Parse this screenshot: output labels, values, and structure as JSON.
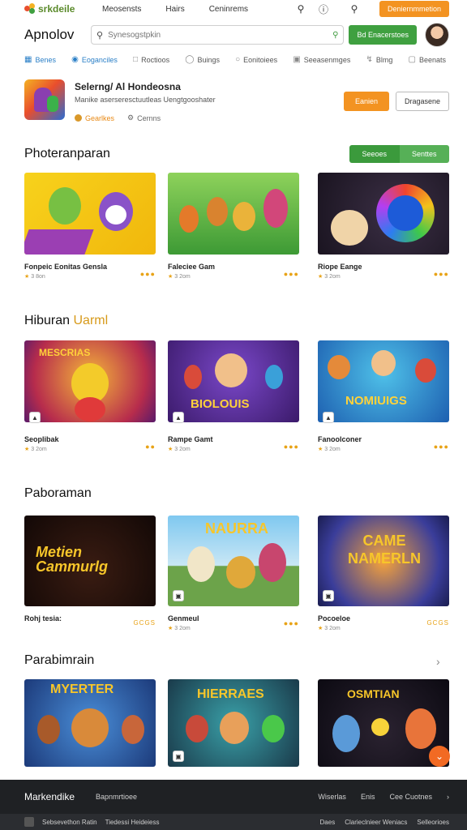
{
  "topbar": {
    "brand": "srkdeile",
    "nav": [
      "Meosensts",
      "Hairs",
      "Ceninrems"
    ],
    "cta": "Deniernmmetion"
  },
  "header": {
    "title": "Apnolov",
    "search_placeholder": "Synesogstpkin",
    "green_button": "Bd Enacerstoes"
  },
  "categories": [
    {
      "label": "Benes",
      "icon": "grid-icon",
      "active": true
    },
    {
      "label": "Eoganciles",
      "icon": "controller-icon",
      "active": true
    },
    {
      "label": "Roctioos",
      "icon": "square-icon",
      "active": false
    },
    {
      "label": "Buings",
      "icon": "shield-icon",
      "active": false
    },
    {
      "label": "Eonitoiees",
      "icon": "circle-icon",
      "active": false
    },
    {
      "label": "Seeasenmges",
      "icon": "box-icon",
      "active": false
    },
    {
      "label": "Blmg",
      "icon": "bolt-icon",
      "active": false
    },
    {
      "label": "Beenats",
      "icon": "tag-icon",
      "active": false
    }
  ],
  "featured": {
    "title": "Selerng/ Al Hondeosna",
    "subtitle": "Manike aserseresctuutleas Uengtgooshater",
    "meta1": "Gearlkes",
    "meta2": "Cernns",
    "primary_btn": "Eanien",
    "secondary_btn": "Dragasene"
  },
  "sections": [
    {
      "title": "Photeranparan",
      "title_highlight": "",
      "segment": [
        "Seeoes",
        "Senttes"
      ],
      "cards": [
        {
          "name": "Fonpeic Eonitas Gensla",
          "stat": "3 8on"
        },
        {
          "name": "Faleciee Gam",
          "stat": "3 2om"
        },
        {
          "name": "Riope Eange",
          "stat": "3 2om"
        }
      ]
    },
    {
      "title": "Hiburan",
      "title_highlight": "Uarml",
      "cards": [
        {
          "name": "Seoplibak",
          "stat": "3 2om"
        },
        {
          "name": "Rampe Gamt",
          "stat": "3 2om"
        },
        {
          "name": "Fanoolconer",
          "stat": "3 2om"
        }
      ]
    },
    {
      "title": "Paboraman",
      "title_highlight": "",
      "cards": [
        {
          "name": "Rohj tesia:",
          "stat": "",
          "dots": "GCGS"
        },
        {
          "name": "Genmeul",
          "stat": "3 2om"
        },
        {
          "name": "Pocoeloe",
          "stat": "3 2om",
          "dots": "GCGS"
        }
      ]
    },
    {
      "title": "Parabimrain",
      "title_highlight": "",
      "cards": [
        {
          "name": "",
          "stat": ""
        },
        {
          "name": "",
          "stat": ""
        },
        {
          "name": "",
          "stat": ""
        }
      ]
    }
  ],
  "thumb_text": {
    "r2c1": "MESCRIAS",
    "r2c2": "BIOLOUIS",
    "r2c3": "NOMIUIGS",
    "r3c1": "Metien Cammurlg",
    "r3c2": "NAURRA",
    "r3c3": "CAME NAMERLN",
    "r4c1": "MYERTER",
    "r4c2": "HIERRAES",
    "r4c3": "OSMTIAN"
  },
  "footer": {
    "brand": "Markendike",
    "tagline": "Bapnmrtioee",
    "links": [
      "Wiserlas",
      "Enis",
      "Cee Cuotnes"
    ],
    "bottom_left": [
      "Sebsevethon Ratin",
      "Tiedessi Heideiess"
    ],
    "bottom_right": [
      "Daes",
      "Clarieclnieer Weniacs",
      "Selleorioes"
    ]
  },
  "colors": {
    "accent_orange": "#f39321",
    "accent_green": "#3fa040",
    "link_blue": "#2a7fc7",
    "footer_bg": "#1f2124"
  }
}
